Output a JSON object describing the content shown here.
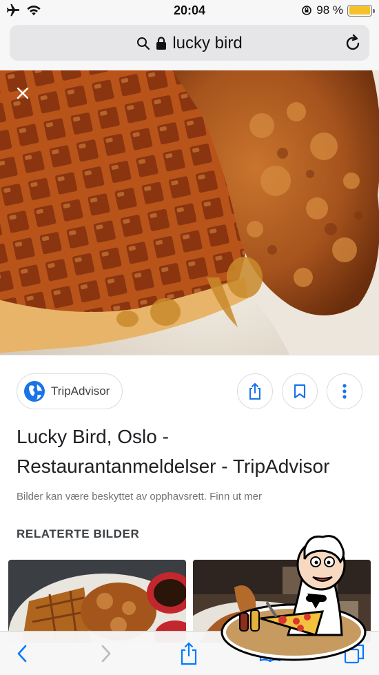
{
  "status_bar": {
    "time": "20:04",
    "battery_percent_label": "98 %",
    "battery_level": 0.98,
    "icons": [
      "airplane-icon",
      "wifi-icon",
      "orientation-lock-icon",
      "battery-icon"
    ]
  },
  "browser": {
    "address_text": "lucky bird",
    "icons": [
      "search-icon",
      "lock-icon",
      "reload-icon"
    ]
  },
  "image_viewer": {
    "close_icon": "close-icon",
    "source_name": "TripAdvisor",
    "actions": [
      "share-icon",
      "bookmark-icon",
      "more-vertical-icon"
    ],
    "title": "Lucky Bird, Oslo - Restaurantanmeldelser - TripAdvisor",
    "copyright_note": "Bilder kan være beskyttet av opphavsrett. Finn ut mer",
    "related_heading": "RELATERTE BILDER"
  },
  "toolbar": {
    "icons": [
      "back-icon",
      "forward-icon",
      "share-icon",
      "bookmarks-icon",
      "tabs-icon"
    ]
  },
  "colors": {
    "accent_blue": "#1a73e8",
    "battery_yellow": "#f4c228",
    "ios_blue": "#007aff"
  }
}
